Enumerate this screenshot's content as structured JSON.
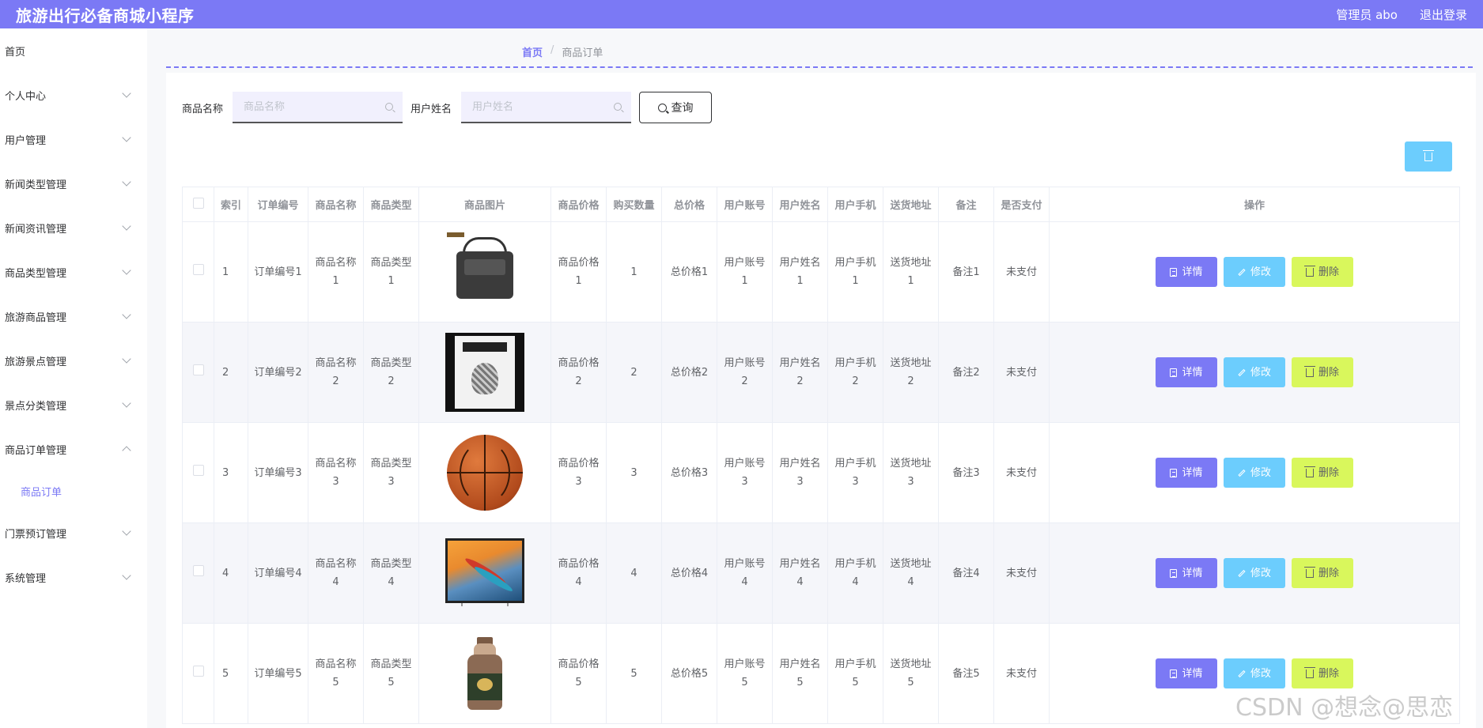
{
  "header": {
    "app_title": "旅游出行必备商城小程序",
    "user_label": "管理员 abo",
    "logout_label": "退出登录"
  },
  "sidebar": {
    "items": [
      {
        "label": "首页",
        "has_children": false
      },
      {
        "label": "个人中心",
        "has_children": true
      },
      {
        "label": "用户管理",
        "has_children": true
      },
      {
        "label": "新闻类型管理",
        "has_children": true
      },
      {
        "label": "新闻资讯管理",
        "has_children": true
      },
      {
        "label": "商品类型管理",
        "has_children": true
      },
      {
        "label": "旅游商品管理",
        "has_children": true
      },
      {
        "label": "旅游景点管理",
        "has_children": true
      },
      {
        "label": "景点分类管理",
        "has_children": true
      },
      {
        "label": "商品订单管理",
        "has_children": true,
        "expanded": true
      },
      {
        "label": "门票预订管理",
        "has_children": true
      },
      {
        "label": "系统管理",
        "has_children": true
      }
    ],
    "subitem_active": "商品订单"
  },
  "breadcrumb": {
    "home": "首页",
    "separator": "/",
    "current": "商品订单"
  },
  "search": {
    "product_label": "商品名称",
    "product_placeholder": "商品名称",
    "user_label": "用户姓名",
    "user_placeholder": "用户姓名",
    "query_label": "查询"
  },
  "table": {
    "headers": [
      "索引",
      "订单编号",
      "商品名称",
      "商品类型",
      "商品图片",
      "商品价格",
      "购买数量",
      "总价格",
      "用户账号",
      "用户姓名",
      "用户手机",
      "送货地址",
      "备注",
      "是否支付",
      "操作"
    ],
    "rows": [
      {
        "index": "1",
        "order_no": "订单编号1",
        "name_a": "商品名称",
        "name_b": "1",
        "type_a": "商品类型",
        "type_b": "1",
        "price_a": "商品价格",
        "price_b": "1",
        "qty": "1",
        "total": "总价格1",
        "acct_a": "用户账号",
        "acct_b": "1",
        "uname_a": "用户姓名",
        "uname_b": "1",
        "phone_a": "用户手机",
        "phone_b": "1",
        "addr_a": "送货地址",
        "addr_b": "1",
        "remark": "备注1",
        "paid": "未支付"
      },
      {
        "index": "2",
        "order_no": "订单编号2",
        "name_a": "商品名称",
        "name_b": "2",
        "type_a": "商品类型",
        "type_b": "2",
        "price_a": "商品价格",
        "price_b": "2",
        "qty": "2",
        "total": "总价格2",
        "acct_a": "用户账号",
        "acct_b": "2",
        "uname_a": "用户姓名",
        "uname_b": "2",
        "phone_a": "用户手机",
        "phone_b": "2",
        "addr_a": "送货地址",
        "addr_b": "2",
        "remark": "备注2",
        "paid": "未支付"
      },
      {
        "index": "3",
        "order_no": "订单编号3",
        "name_a": "商品名称",
        "name_b": "3",
        "type_a": "商品类型",
        "type_b": "3",
        "price_a": "商品价格",
        "price_b": "3",
        "qty": "3",
        "total": "总价格3",
        "acct_a": "用户账号",
        "acct_b": "3",
        "uname_a": "用户姓名",
        "uname_b": "3",
        "phone_a": "用户手机",
        "phone_b": "3",
        "addr_a": "送货地址",
        "addr_b": "3",
        "remark": "备注3",
        "paid": "未支付"
      },
      {
        "index": "4",
        "order_no": "订单编号4",
        "name_a": "商品名称",
        "name_b": "4",
        "type_a": "商品类型",
        "type_b": "4",
        "price_a": "商品价格",
        "price_b": "4",
        "qty": "4",
        "total": "总价格4",
        "acct_a": "用户账号",
        "acct_b": "4",
        "uname_a": "用户姓名",
        "uname_b": "4",
        "phone_a": "用户手机",
        "phone_b": "4",
        "addr_a": "送货地址",
        "addr_b": "4",
        "remark": "备注4",
        "paid": "未支付"
      },
      {
        "index": "5",
        "order_no": "订单编号5",
        "name_a": "商品名称",
        "name_b": "5",
        "type_a": "商品类型",
        "type_b": "5",
        "price_a": "商品价格",
        "price_b": "5",
        "qty": "5",
        "total": "总价格5",
        "acct_a": "用户账号",
        "acct_b": "5",
        "uname_a": "用户姓名",
        "uname_b": "5",
        "phone_a": "用户手机",
        "phone_b": "5",
        "addr_a": "送货地址",
        "addr_b": "5",
        "remark": "备注5",
        "paid": "未支付"
      }
    ],
    "images": [
      "bag",
      "book",
      "basketball",
      "tv",
      "bottle"
    ],
    "actions": {
      "detail": "详情",
      "edit": "修改",
      "delete": "删除"
    }
  },
  "watermark": "CSDN @想念@思恋",
  "colors": {
    "primary": "#7b79f5",
    "info": "#6ccdfd",
    "lime": "#d9f75c"
  }
}
